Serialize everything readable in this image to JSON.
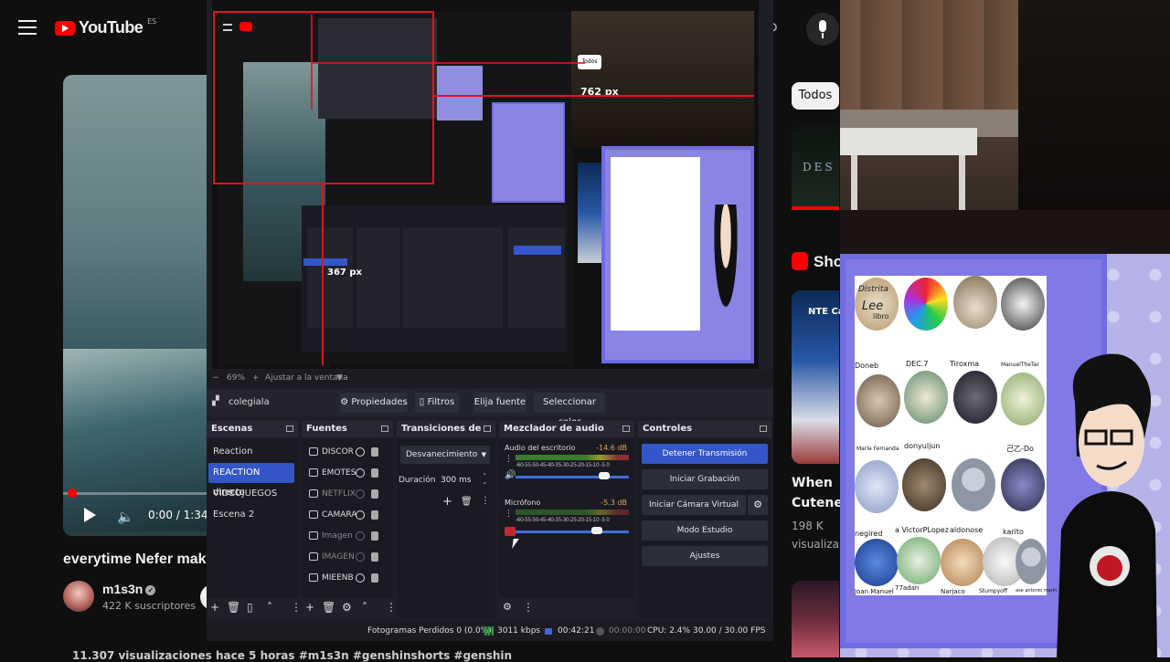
{
  "youtube": {
    "logo_text": "YouTube",
    "region": "ES",
    "time": "0:00 / 1:34",
    "video_title": "everytime Nefer mak",
    "channel": "m1s3n",
    "subscribers": "422 K suscriptores",
    "views_line": "11.307 visualizaciones  hace 5 horas  #m1s3n #genshinshorts #genshin",
    "filter_chip": "Todos",
    "related_thumb_text": "DES",
    "shorts_label": "Sho",
    "short1_overlay": "NTE Cat v",
    "short1_title_1": "When",
    "short1_title_2": "Cuteness",
    "short1_views_1": "198 K",
    "short1_views_2": "visualiza",
    "progress_fraction": 0.06
  },
  "obs": {
    "preview_label_762": "762 px",
    "preview_label_367": "367 px",
    "preview_chip": "Todos",
    "zoom": "69%",
    "zoom_mode": "Ajustar a la ventana",
    "selected_source": "colegiala",
    "source_buttons": {
      "properties": "Propiedades",
      "filters": "Filtros",
      "choose_source": "Elija fuente",
      "pick_color": "Seleccionar color"
    },
    "docks": {
      "scenes": "Escenas",
      "sources": "Fuentes",
      "transitions": "Transiciones de e...",
      "mixer": "Mezclador de audio",
      "controls": "Controles"
    },
    "scenes": [
      "Reaction",
      "REACTION directo",
      "VIDEOJUEGOS",
      "Escena 2"
    ],
    "active_scene": "REACTION directo",
    "sources": [
      {
        "name": "DISCOR",
        "visible": true
      },
      {
        "name": "EMOTES",
        "visible": true
      },
      {
        "name": "NETFLIX",
        "visible": false
      },
      {
        "name": "CAMARA",
        "visible": true
      },
      {
        "name": "Imagen",
        "visible": false
      },
      {
        "name": "IMAGEN",
        "visible": false
      },
      {
        "name": "MIEENB",
        "visible": true
      }
    ],
    "transition": {
      "type": "Desvanecimiento",
      "duration_label": "Duración",
      "duration_value": "300 ms"
    },
    "mixer": [
      {
        "name": "Audio del escritorio",
        "db": "-14.6 dB",
        "level": 0.78
      },
      {
        "name": "Micrófono",
        "db": "-5.3 dB",
        "level": 0.72
      }
    ],
    "meter_ticks": "-60-55-50-45-40-35-30-25-20-15-10 -5  0",
    "controls": {
      "stop_stream": "Detener Transmisión",
      "start_recording": "Iniciar Grabación",
      "start_virtual_cam": "Iniciar Cámara Virtual",
      "studio_mode": "Modo Estudio",
      "settings": "Ajustes"
    },
    "status": {
      "dropped_frames": "Fotogramas Perdidos 0 (0.0%)",
      "bitrate": "3011 kbps",
      "stream_time": "00:42:21",
      "rec_time": "00:00:00",
      "cpu": "CPU: 2.4%",
      "fps": "30.00 / 30.00 FPS"
    }
  },
  "overlay": {
    "names": [
      "Doneb",
      "DEC.7",
      "Tiroxma",
      "ManuelTheTar",
      "Marla Fernanda",
      "donyuljun",
      "",
      "己乙-Do",
      "negired",
      "a VictorPLopez",
      "aldonose",
      "karito",
      "Joan Manuel",
      "77adan",
      "Narjaco",
      "Stumpyoff",
      "ase antonio marin"
    ],
    "sign_line1": "Distrita",
    "sign_line2": "Lee",
    "sign_line3": "libro"
  },
  "colors": {
    "youtube_red": "#ff0000",
    "obs_accent": "#3456c8",
    "overlay_purple": "#8079e6"
  }
}
